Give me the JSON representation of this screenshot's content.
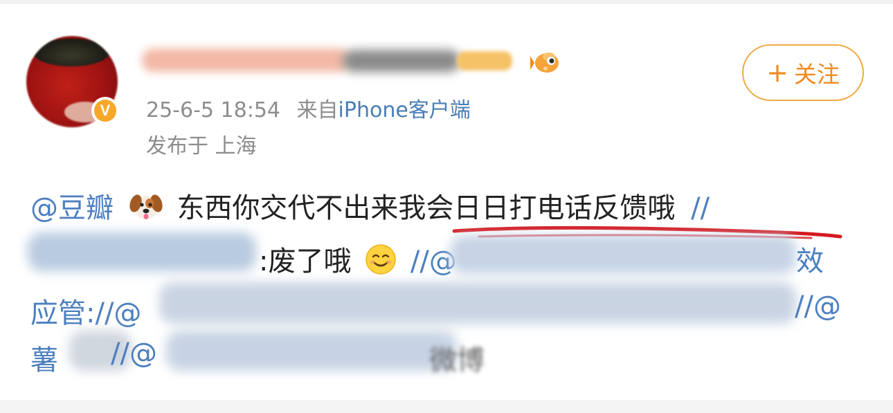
{
  "post": {
    "follow_label": "关注",
    "follow_plus": "+",
    "verified_badge": "V",
    "timestamp": "25-6-5 18:54",
    "source_prefix": "来自",
    "source_app": "iPhone客户端",
    "location": "发布于 上海"
  },
  "content": {
    "line1": {
      "mention": "@豆瓣",
      "text": "东西你交代不出来我会日日打电话反馈哦",
      "slash": "//"
    },
    "line2": {
      "mention_start": "@",
      "text": ":废了哦",
      "slash": "//",
      "mention_at": "@",
      "trail": "效"
    },
    "line3": {
      "text": "应管",
      "slash": "://@",
      "slash_end": "//@"
    },
    "line4": {
      "text": "薯",
      "slash": "//@",
      "text2": "微博"
    }
  },
  "icons": {
    "dog": "dog-face-emoji",
    "smile": "smiling-face-emoji",
    "fish": "fish-badge-icon"
  },
  "colors": {
    "accent_orange": "#f08a1c",
    "link_blue": "#4c7fbf",
    "meta_gray": "#8c8c8c",
    "underline_red": "#d6191f"
  }
}
